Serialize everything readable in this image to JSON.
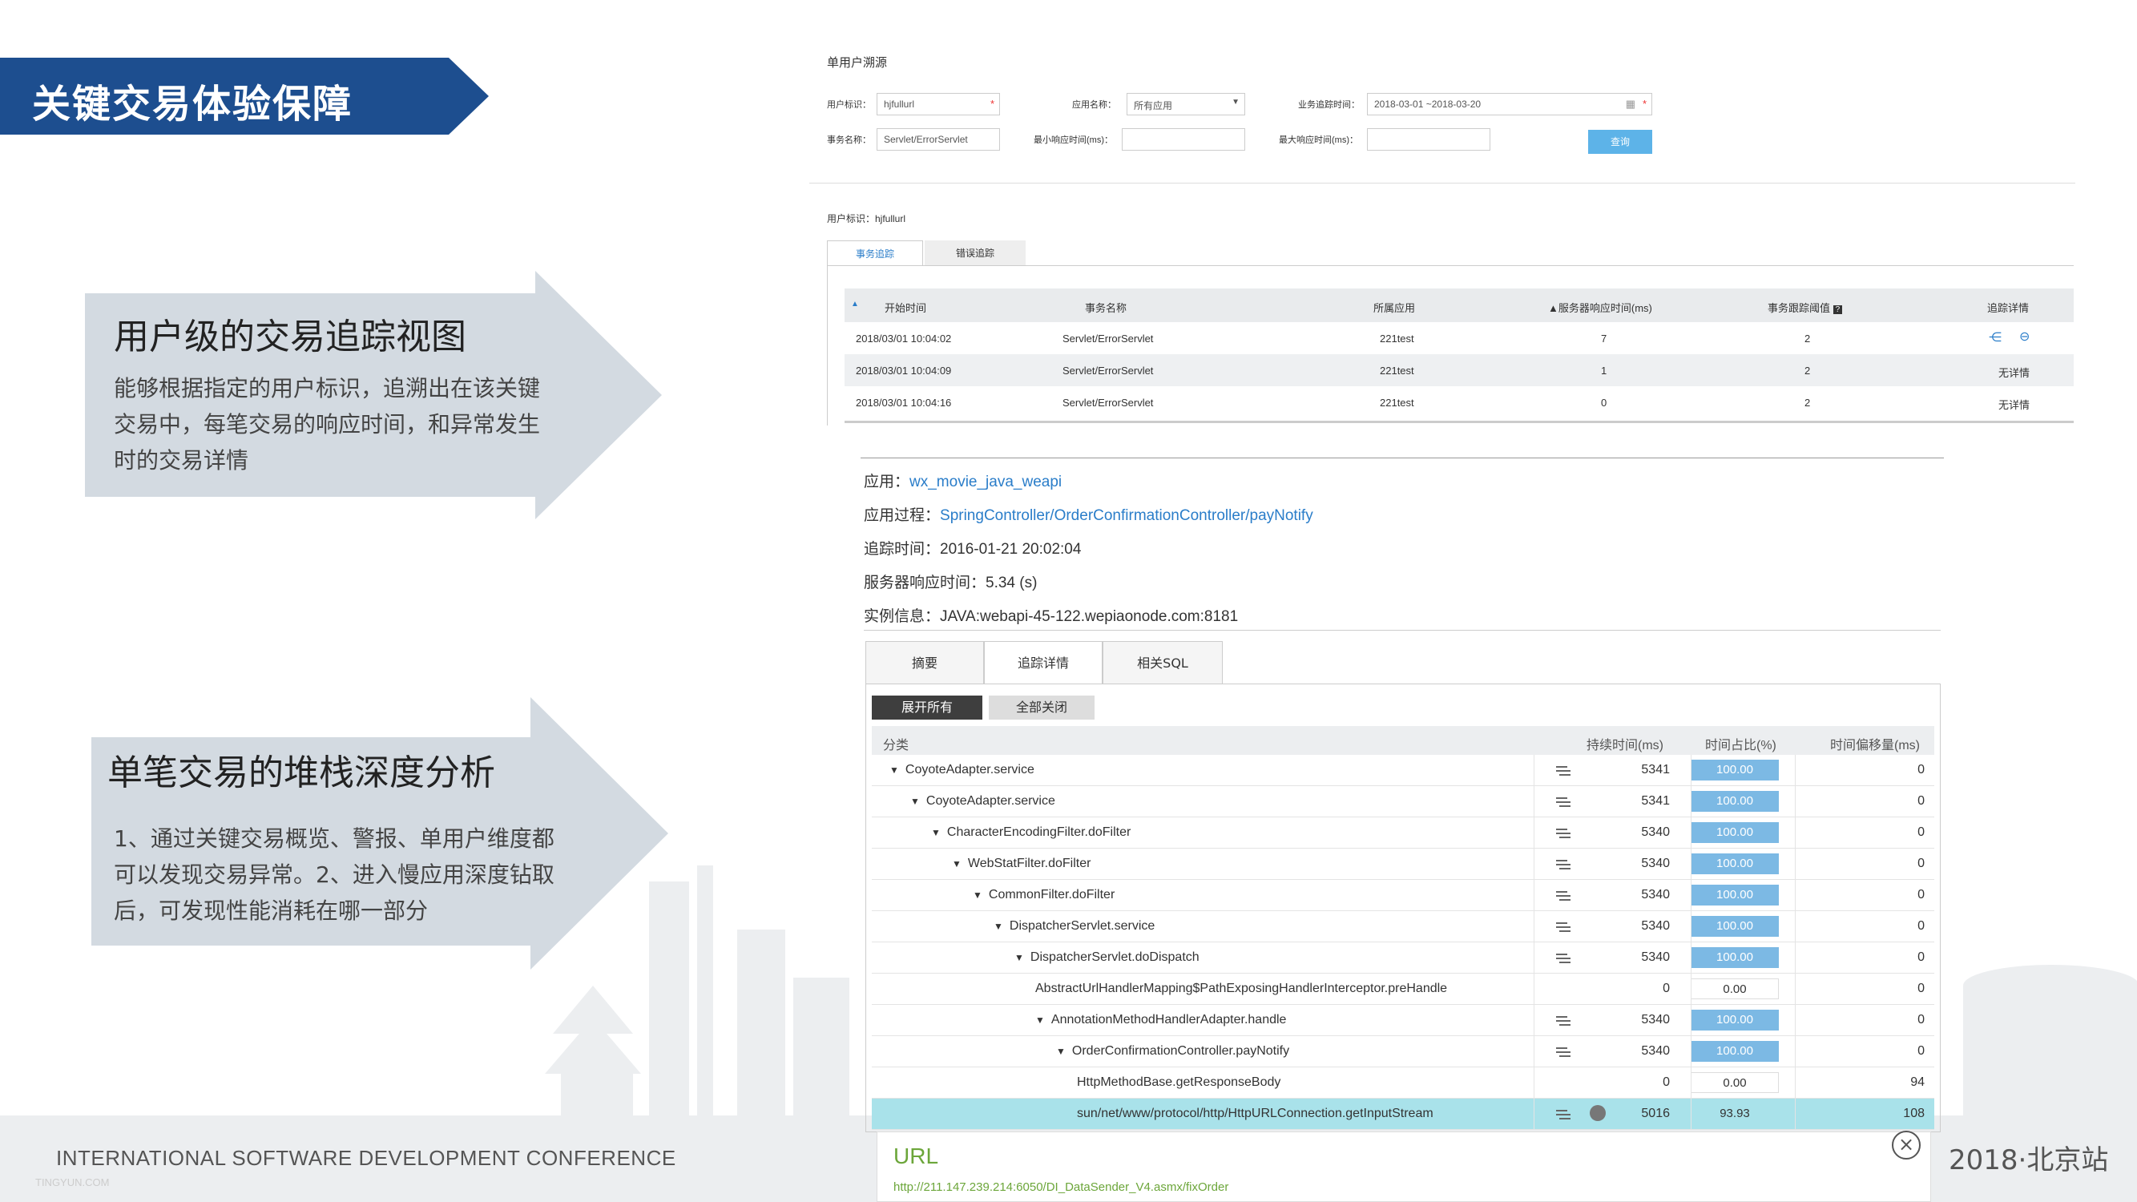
{
  "slide": {
    "title": "关键交易体验保障",
    "section1": {
      "heading": "用户级的交易追踪视图",
      "lines": [
        "能够根据指定的用户标识，追溯出在该关键",
        "交易中，每笔交易的响应时间，和异常发生",
        "时的交易详情"
      ]
    },
    "section2": {
      "heading": "单笔交易的堆栈深度分析",
      "lines": [
        "1、通过关键交易概览、警报、单用户维度都",
        "可以发现交易异常。2、进入慢应用深度钻取",
        "后，可发现性能消耗在哪一部分"
      ]
    },
    "footer": {
      "conference": "INTERNATIONAL SOFTWARE DEVELOPMENT CONFERENCE",
      "year": "2018·北京站",
      "watermark": "TINGYUN.COM"
    }
  },
  "trace_search": {
    "title": "单用户溯源",
    "user_id_label": "用户标识：",
    "user_id_value": "hjfullurl",
    "app_label": "应用名称：",
    "app_value": "所有应用",
    "time_label": "业务追踪时间：",
    "time_value": "2018-03-01 ~2018-03-20",
    "tx_label": "事务名称：",
    "tx_value": "Servlet/ErrorServlet",
    "min_label": "最小响应时间(ms)：",
    "max_label": "最大响应时间(ms)：",
    "query_label": "查询",
    "user_line": "用户标识：hjfullurl",
    "tabs": [
      "事务追踪",
      "错误追踪"
    ],
    "columns": [
      "开始时间",
      "事务名称",
      "所属应用",
      "服务器响应时间(ms)",
      "事务跟踪阈值",
      "追踪详情"
    ],
    "rows": [
      {
        "time": "2018/03/01 10:04:02",
        "tx": "Servlet/ErrorServlet",
        "app": "221test",
        "resp": "7",
        "thr": "2",
        "detail": ""
      },
      {
        "time": "2018/03/01 10:04:09",
        "tx": "Servlet/ErrorServlet",
        "app": "221test",
        "resp": "1",
        "thr": "2",
        "detail": "无详情"
      },
      {
        "time": "2018/03/01 10:04:16",
        "tx": "Servlet/ErrorServlet",
        "app": "221test",
        "resp": "0",
        "thr": "2",
        "detail": "无详情"
      }
    ]
  },
  "detail": {
    "app_label": "应用：",
    "app_value": "wx_movie_java_weapi",
    "proc_label": "应用过程：",
    "proc_value": "SpringController/OrderConfirmationController/payNotify",
    "time_label": "追踪时间：",
    "time_value": "2016-01-21 20:02:04",
    "resp_label": "服务器响应时间：",
    "resp_value": "5.34 (s)",
    "inst_label": "实例信息：",
    "inst_value": "JAVA:webapi-45-122.wepiaonode.com:8181",
    "tabs": [
      "摘要",
      "追踪详情",
      "相关SQL"
    ],
    "expand_all": "展开所有",
    "collapse_all": "全部关闭",
    "columns": [
      "分类",
      "持续时间(ms)",
      "时间占比(%)",
      "时间偏移量(ms)"
    ],
    "rows": [
      {
        "name": "CoyoteAdapter.service",
        "level": 0,
        "toggle": "▼",
        "dur": "5341",
        "pct": "100.00",
        "off": "0",
        "hl": true
      },
      {
        "name": "CoyoteAdapter.service",
        "level": 1,
        "toggle": "▼",
        "dur": "5341",
        "pct": "100.00",
        "off": "0",
        "hl": true
      },
      {
        "name": "CharacterEncodingFilter.doFilter",
        "level": 2,
        "toggle": "▼",
        "dur": "5340",
        "pct": "100.00",
        "off": "0",
        "hl": true
      },
      {
        "name": "WebStatFilter.doFilter",
        "level": 3,
        "toggle": "▼",
        "dur": "5340",
        "pct": "100.00",
        "off": "0",
        "hl": true
      },
      {
        "name": "CommonFilter.doFilter",
        "level": 4,
        "toggle": "▼",
        "dur": "5340",
        "pct": "100.00",
        "off": "0",
        "hl": true
      },
      {
        "name": "DispatcherServlet.service",
        "level": 5,
        "toggle": "▼",
        "dur": "5340",
        "pct": "100.00",
        "off": "0",
        "hl": true
      },
      {
        "name": "DispatcherServlet.doDispatch",
        "level": 6,
        "toggle": "▼",
        "dur": "5340",
        "pct": "100.00",
        "off": "0",
        "hl": true
      },
      {
        "name": "AbstractUrlHandlerMapping$PathExposingHandlerInterceptor.preHandle",
        "level": 7,
        "toggle": "",
        "dur": "0",
        "pct": "0.00",
        "off": "0",
        "hl": false
      },
      {
        "name": "AnnotationMethodHandlerAdapter.handle",
        "level": 7,
        "toggle": "▼",
        "dur": "5340",
        "pct": "100.00",
        "off": "0",
        "hl": true
      },
      {
        "name": "OrderConfirmationController.payNotify",
        "level": 8,
        "toggle": "▼",
        "dur": "5340",
        "pct": "100.00",
        "off": "0",
        "hl": true
      },
      {
        "name": "HttpMethodBase.getResponseBody",
        "level": 9,
        "toggle": "",
        "dur": "0",
        "pct": "0.00",
        "off": "94",
        "hl": false
      },
      {
        "name": "sun/net/www/protocol/http/HttpURLConnection.getInputStream",
        "level": 9,
        "toggle": "",
        "dur": "5016",
        "pct": "93.93",
        "off": "108",
        "hl": true
      }
    ],
    "url_label": "URL",
    "url_value": "http://211.147.239.214:6050/DI_DataSender_V4.asmx/fixOrder",
    "colors": {
      "accent": "#2a7dc9",
      "bar": "#7cb9e4",
      "selected": "#a9e2ea",
      "banner": "#1d4e8f",
      "url_green": "#6ca63a"
    }
  }
}
